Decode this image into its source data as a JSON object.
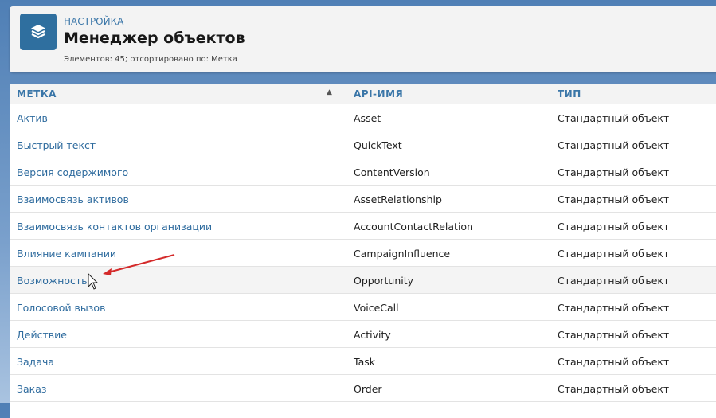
{
  "header": {
    "breadcrumb": "НАСТРОЙКА",
    "title": "Менеджер объектов",
    "subtitle": "Элементов: 45; отсортировано по: Метка"
  },
  "table": {
    "columns": [
      "МЕТКА",
      "API-ИМЯ",
      "ТИП"
    ],
    "sort_indicator": "▲",
    "rows": [
      {
        "label": "Актив",
        "api": "Asset",
        "type": "Стандартный объект"
      },
      {
        "label": "Быстрый текст",
        "api": "QuickText",
        "type": "Стандартный объект"
      },
      {
        "label": "Версия содержимого",
        "api": "ContentVersion",
        "type": "Стандартный объект"
      },
      {
        "label": "Взаимосвязь активов",
        "api": "AssetRelationship",
        "type": "Стандартный объект"
      },
      {
        "label": "Взаимосвязь контактов организации",
        "api": "AccountContactRelation",
        "type": "Стандартный объект"
      },
      {
        "label": "Влияние кампании",
        "api": "CampaignInfluence",
        "type": "Стандартный объект"
      },
      {
        "label": "Возможность",
        "api": "Opportunity",
        "type": "Стандартный объект"
      },
      {
        "label": "Голосовой вызов",
        "api": "VoiceCall",
        "type": "Стандартный объект"
      },
      {
        "label": "Действие",
        "api": "Activity",
        "type": "Стандартный объект"
      },
      {
        "label": "Задача",
        "api": "Task",
        "type": "Стандартный объект"
      },
      {
        "label": "Заказ",
        "api": "Order",
        "type": "Стандартный объект"
      }
    ]
  },
  "hovered_row": 6,
  "colors": {
    "accent": "#3a76a8",
    "annotation_arrow": "#d42a2a"
  }
}
